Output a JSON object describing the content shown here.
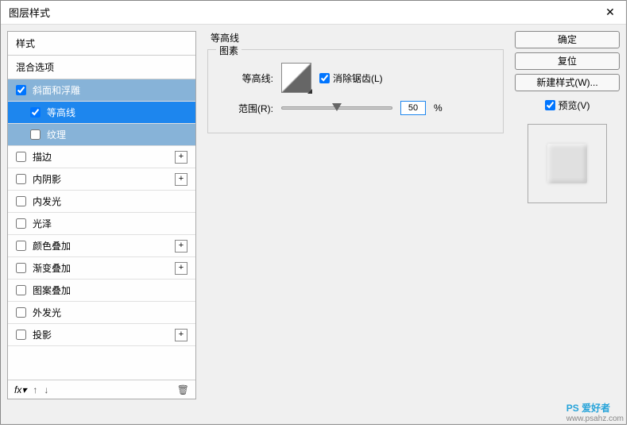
{
  "window": {
    "title": "图层样式",
    "close_glyph": "✕"
  },
  "styles": {
    "header": "样式",
    "blend_options": "混合选项",
    "items": [
      {
        "label": "斜面和浮雕",
        "checked": true,
        "indent": false,
        "sel": 1,
        "plus": false
      },
      {
        "label": "等高线",
        "checked": true,
        "indent": true,
        "sel": 2,
        "plus": false
      },
      {
        "label": "纹理",
        "checked": false,
        "indent": true,
        "sel": 3,
        "plus": false
      },
      {
        "label": "描边",
        "checked": false,
        "indent": false,
        "sel": 0,
        "plus": true
      },
      {
        "label": "内阴影",
        "checked": false,
        "indent": false,
        "sel": 0,
        "plus": true
      },
      {
        "label": "内发光",
        "checked": false,
        "indent": false,
        "sel": 0,
        "plus": false
      },
      {
        "label": "光泽",
        "checked": false,
        "indent": false,
        "sel": 0,
        "plus": false
      },
      {
        "label": "颜色叠加",
        "checked": false,
        "indent": false,
        "sel": 0,
        "plus": true
      },
      {
        "label": "渐变叠加",
        "checked": false,
        "indent": false,
        "sel": 0,
        "plus": true
      },
      {
        "label": "图案叠加",
        "checked": false,
        "indent": false,
        "sel": 0,
        "plus": false
      },
      {
        "label": "外发光",
        "checked": false,
        "indent": false,
        "sel": 0,
        "plus": false
      },
      {
        "label": "投影",
        "checked": false,
        "indent": false,
        "sel": 0,
        "plus": true
      }
    ],
    "footer": {
      "fx": "fx",
      "up": "↑",
      "down": "↓",
      "trash": "🗑"
    }
  },
  "contour": {
    "section_title": "等高线",
    "group_title": "图素",
    "row_label": "等高线:",
    "antialias_label": "消除锯齿(L)",
    "antialias_checked": true,
    "range_label": "范围(R):",
    "range_value": "50",
    "percent": "%"
  },
  "buttons": {
    "ok": "确定",
    "reset": "复位",
    "new_style": "新建样式(W)...",
    "preview_label": "预览(V)",
    "preview_checked": true
  },
  "watermark": {
    "main": "PS 爱好者",
    "sub": "www.psahz.com"
  }
}
